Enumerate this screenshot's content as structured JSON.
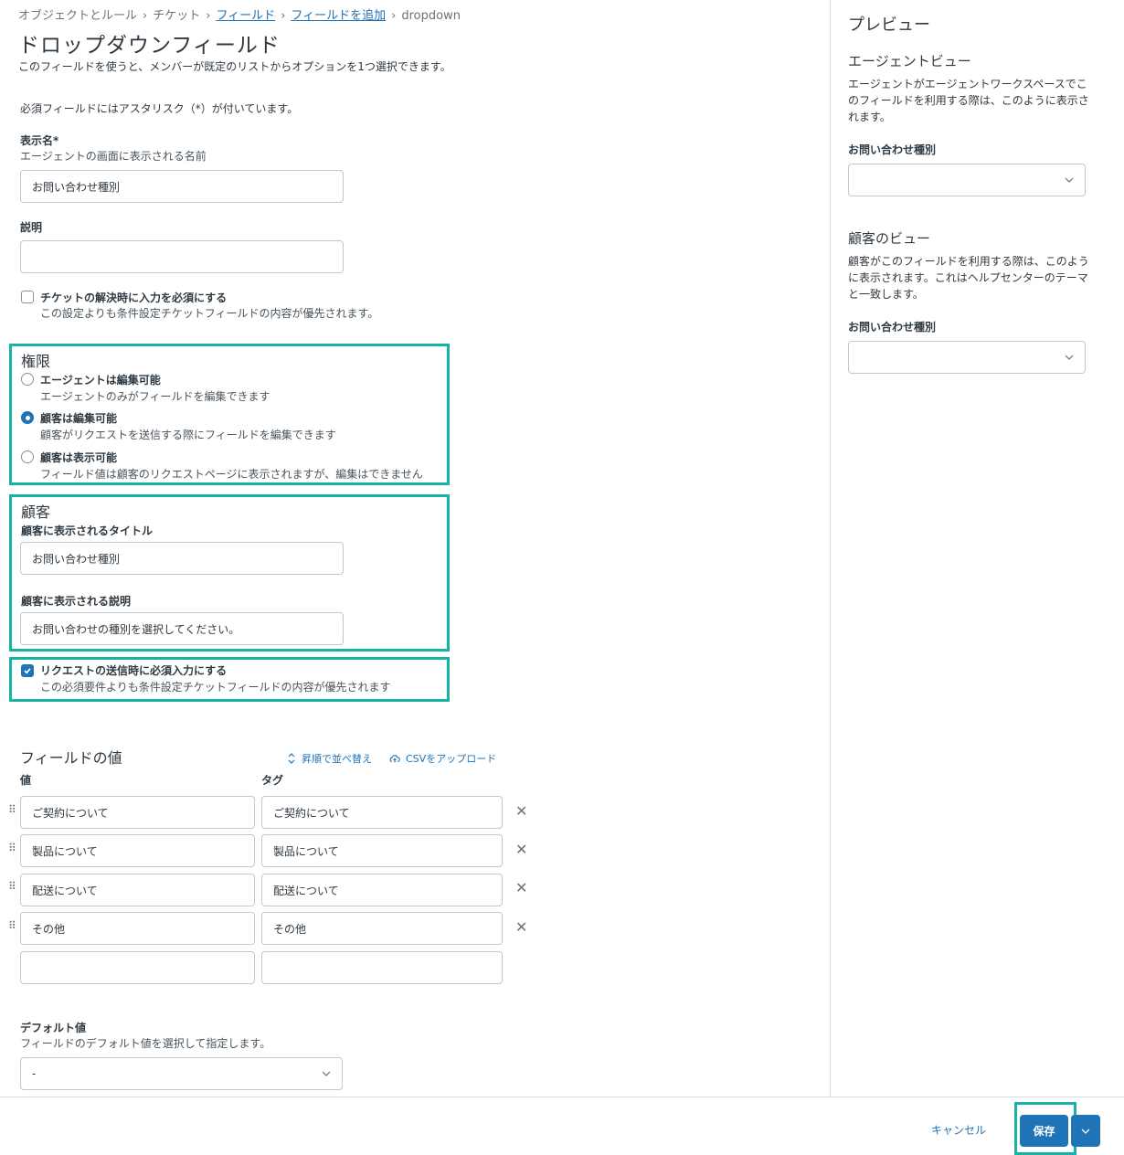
{
  "breadcrumb": {
    "items": [
      "オブジェクトとルール",
      "チケット",
      "フィールド",
      "フィールドを追加",
      "dropdown"
    ]
  },
  "page": {
    "title": "ドロップダウンフィールド",
    "subtitle": "このフィールドを使うと、メンバーが既定のリストからオプションを1つ選択できます。",
    "required_note": "必須フィールドにはアスタリスク（*）が付いています。"
  },
  "form": {
    "display_name_label": "表示名*",
    "display_name_hint": "エージェントの画面に表示される名前",
    "display_name_value": "お問い合わせ種別",
    "description_label": "説明",
    "description_value": "",
    "required_on_solve_label": "チケットの解決時に入力を必須にする",
    "required_on_solve_hint": "この設定よりも条件設定チケットフィールドの内容が優先されます。",
    "required_on_solve_checked": false
  },
  "permissions": {
    "title": "権限",
    "options": [
      {
        "label": "エージェントは編集可能",
        "hint": "エージェントのみがフィールドを編集できます",
        "checked": false
      },
      {
        "label": "顧客は編集可能",
        "hint": "顧客がリクエストを送信する際にフィールドを編集できます",
        "checked": true
      },
      {
        "label": "顧客は表示可能",
        "hint": "フィールド値は顧客のリクエストページに表示されますが、編集はできません",
        "checked": false
      }
    ]
  },
  "customer": {
    "title": "顧客",
    "title_label": "顧客に表示されるタイトル",
    "title_value": "お問い合わせ種別",
    "desc_label": "顧客に表示される説明",
    "desc_value": "お問い合わせの種別を選択してください。"
  },
  "require_on_submit": {
    "label": "リクエストの送信時に必須入力にする",
    "hint": "この必須要件よりも条件設定チケットフィールドの内容が優先されます",
    "checked": true
  },
  "field_values": {
    "title": "フィールドの値",
    "sort_label": "昇順で並べ替え",
    "csv_label": "CSVをアップロード",
    "col_value": "値",
    "col_tag": "タグ",
    "rows": [
      {
        "value": "ご契約について",
        "tag": "ご契約について"
      },
      {
        "value": "製品について",
        "tag": "製品について"
      },
      {
        "value": "配送について",
        "tag": "配送について"
      },
      {
        "value": "その他",
        "tag": "その他"
      },
      {
        "value": "",
        "tag": ""
      }
    ]
  },
  "default_value": {
    "label": "デフォルト値",
    "hint": "フィールドのデフォルト値を選択して指定します。",
    "selected": "-"
  },
  "preview": {
    "title": "プレビュー",
    "agent_view_title": "エージェントビュー",
    "agent_view_text": "エージェントがエージェントワークスペースでこのフィールドを利用する際は、このように表示されます。",
    "agent_field_label": "お問い合わせ種別",
    "customer_view_title": "顧客のビュー",
    "customer_view_text": "顧客がこのフィールドを利用する際は、このように表示されます。これはヘルプセンターのテーマと一致します。",
    "customer_field_label": "お問い合わせ種別"
  },
  "footer": {
    "cancel_label": "キャンセル",
    "save_label": "保存"
  },
  "colors": {
    "accent": "#1f73b7",
    "highlight": "#17b3a3"
  }
}
